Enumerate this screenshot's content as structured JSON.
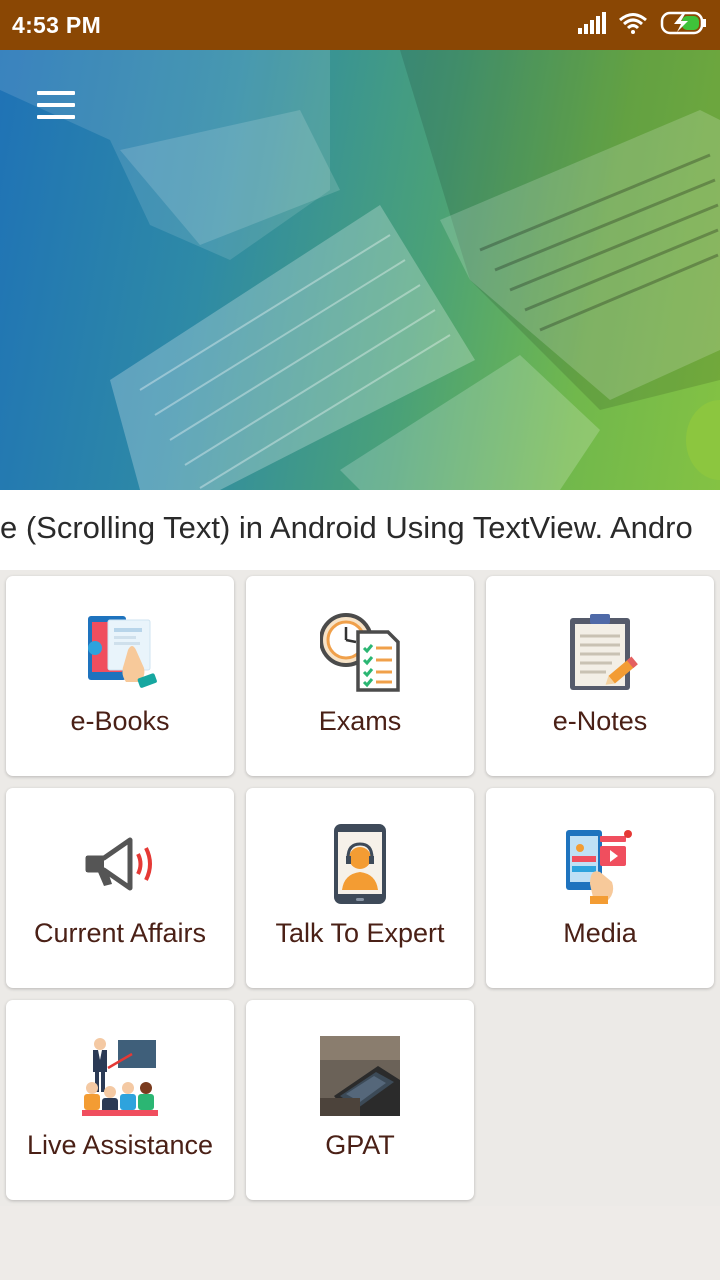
{
  "status_bar": {
    "time": "4:53 PM",
    "icons": [
      "signal-icon",
      "wifi-icon",
      "battery-charging-icon"
    ]
  },
  "hero": {
    "menu_icon": "hamburger-menu-icon",
    "image": "laptop-keyboard-desk-photo"
  },
  "marquee": {
    "text": "e (Scrolling Text) in Android Using TextView. Andro"
  },
  "menu": {
    "items": [
      {
        "label": "e-Books",
        "icon": "ebook-reader-icon"
      },
      {
        "label": "Exams",
        "icon": "exam-clock-checklist-icon"
      },
      {
        "label": "e-Notes",
        "icon": "clipboard-pencil-icon"
      },
      {
        "label": "Current Affairs",
        "icon": "megaphone-icon"
      },
      {
        "label": "Talk To Expert",
        "icon": "expert-tablet-icon"
      },
      {
        "label": "Media",
        "icon": "media-phone-icon"
      },
      {
        "label": "Live Assistance",
        "icon": "teacher-classroom-icon"
      },
      {
        "label": "GPAT",
        "icon": "gpat-thumbnail-icon"
      }
    ]
  },
  "colors": {
    "status_bar": "#8a4704",
    "label_text": "#4a2016",
    "background": "#eeebe8",
    "hero_blue": "#1f72b6",
    "hero_green": "#84c243"
  }
}
